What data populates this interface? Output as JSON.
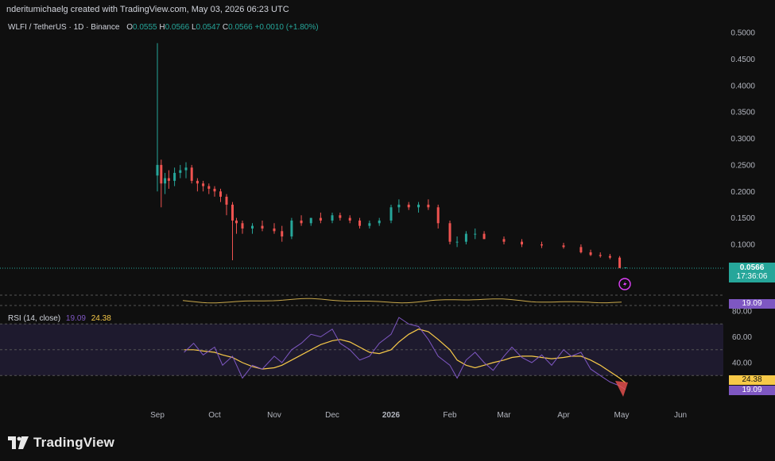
{
  "header": {
    "attribution": "nderitumichaelg created with TradingView.com, May 03, 2026 06:23 UTC"
  },
  "legend": {
    "symbol": "WLFI / TetherUS · 1D · Binance",
    "o_label": "O",
    "o_value": "0.0555",
    "h_label": "H",
    "h_value": "0.0566",
    "l_label": "L",
    "l_value": "0.0547",
    "c_label": "C",
    "c_value": "0.0566",
    "change": "+0.0010 (+1.80%)"
  },
  "rsi_legend": {
    "label": "RSI (14, close)",
    "rsi_value": "19.09",
    "ma_value": "24.38"
  },
  "price_tag": {
    "price": "0.0566",
    "countdown": "17:36:06"
  },
  "mini_tag": {
    "value": "19.09"
  },
  "rsi_tags": {
    "ma": "24.38",
    "rsi": "19.09"
  },
  "colors": {
    "background": "#0f0f0f",
    "up": "#26a69a",
    "down": "#ef5350",
    "rsi_line": "#7e57c2",
    "rsi_ma": "#f7c948",
    "rsi_band": "#1e1a2e",
    "price_tag": "#26a69a",
    "rsi_tag": "#7e57c2",
    "ma_tag": "#f7c948",
    "lightning": "#e040fb"
  },
  "icons": {
    "alert": "lightning-icon",
    "logo": "tradingview-logo-icon"
  },
  "footer": {
    "brand": "TradingView"
  },
  "chart_data": [
    {
      "type": "candlestick",
      "title": "WLFI / TetherUS · 1D · Binance",
      "y_ticks": [
        "0.5000",
        "0.4500",
        "0.4000",
        "0.3500",
        "0.3000",
        "0.2500",
        "0.2000",
        "0.1500",
        "0.1000"
      ],
      "ylim": [
        0.0,
        0.5
      ],
      "x_ticks": [
        "Sep",
        "Oct",
        "Nov",
        "Dec",
        "2026",
        "Feb",
        "Mar",
        "Apr",
        "May",
        "Jun"
      ],
      "grid": false,
      "series": [
        {
          "x": [
            "Sep 01",
            "Sep 03",
            "Sep 05",
            "Sep 07",
            "Sep 10",
            "Sep 13",
            "Sep 16",
            "Sep 19",
            "Sep 22",
            "Sep 25",
            "Sep 28",
            "Oct 01",
            "Oct 04",
            "Oct 07",
            "Oct 10",
            "Oct 12",
            "Oct 15",
            "Oct 20",
            "Oct 25",
            "Nov 01",
            "Nov 05",
            "Nov 10",
            "Nov 15",
            "Nov 20",
            "Nov 25",
            "Dec 01",
            "Dec 05",
            "Dec 10",
            "Dec 15",
            "Dec 20",
            "Dec 25",
            "Jan 01",
            "Jan 05",
            "Jan 10",
            "Jan 15",
            "Jan 20",
            "Jan 25",
            "Feb 01",
            "Feb 05",
            "Feb 10",
            "Feb 15",
            "Feb 20",
            "Mar 01",
            "Mar 10",
            "Mar 20",
            "Apr 01",
            "Apr 10",
            "Apr 15",
            "Apr 20",
            "Apr 25",
            "Apr 30",
            "May 03"
          ],
          "open": [
            0.23,
            0.25,
            0.215,
            0.225,
            0.22,
            0.235,
            0.24,
            0.245,
            0.22,
            0.215,
            0.21,
            0.205,
            0.2,
            0.19,
            0.175,
            0.145,
            0.14,
            0.13,
            0.135,
            0.13,
            0.125,
            0.115,
            0.145,
            0.14,
            0.15,
            0.145,
            0.155,
            0.15,
            0.145,
            0.135,
            0.14,
            0.145,
            0.17,
            0.175,
            0.17,
            0.175,
            0.17,
            0.14,
            0.105,
            0.105,
            0.12,
            0.12,
            0.11,
            0.105,
            0.1,
            0.098,
            0.095,
            0.085,
            0.08,
            0.078,
            0.075,
            0.0555
          ],
          "high": [
            0.48,
            0.26,
            0.235,
            0.24,
            0.245,
            0.25,
            0.255,
            0.25,
            0.225,
            0.22,
            0.215,
            0.21,
            0.205,
            0.195,
            0.18,
            0.15,
            0.145,
            0.14,
            0.145,
            0.14,
            0.135,
            0.15,
            0.155,
            0.15,
            0.16,
            0.16,
            0.16,
            0.155,
            0.15,
            0.145,
            0.15,
            0.175,
            0.185,
            0.18,
            0.18,
            0.185,
            0.175,
            0.145,
            0.115,
            0.125,
            0.13,
            0.125,
            0.115,
            0.11,
            0.105,
            0.103,
            0.1,
            0.09,
            0.085,
            0.082,
            0.078,
            0.0566
          ],
          "low": [
            0.2,
            0.17,
            0.195,
            0.205,
            0.21,
            0.225,
            0.225,
            0.215,
            0.2,
            0.2,
            0.195,
            0.19,
            0.18,
            0.155,
            0.07,
            0.12,
            0.12,
            0.12,
            0.125,
            0.12,
            0.105,
            0.11,
            0.135,
            0.135,
            0.14,
            0.14,
            0.145,
            0.14,
            0.13,
            0.13,
            0.135,
            0.14,
            0.16,
            0.165,
            0.16,
            0.165,
            0.13,
            0.1,
            0.095,
            0.1,
            0.11,
            0.11,
            0.1,
            0.095,
            0.093,
            0.092,
            0.083,
            0.078,
            0.075,
            0.072,
            0.055,
            0.0547
          ],
          "close": [
            0.25,
            0.215,
            0.225,
            0.22,
            0.235,
            0.24,
            0.245,
            0.22,
            0.215,
            0.21,
            0.205,
            0.2,
            0.19,
            0.175,
            0.145,
            0.14,
            0.13,
            0.135,
            0.13,
            0.125,
            0.115,
            0.145,
            0.14,
            0.15,
            0.145,
            0.155,
            0.15,
            0.145,
            0.135,
            0.14,
            0.145,
            0.17,
            0.175,
            0.17,
            0.175,
            0.17,
            0.14,
            0.105,
            0.105,
            0.12,
            0.12,
            0.11,
            0.105,
            0.1,
            0.098,
            0.095,
            0.085,
            0.08,
            0.078,
            0.075,
            0.0555,
            0.0566
          ]
        }
      ]
    },
    {
      "type": "line",
      "title": "RSI (14, close)",
      "y_ticks": [
        "80.00",
        "60.00",
        "40.00"
      ],
      "ylim": [
        10,
        85
      ],
      "bands": [
        70,
        50,
        30
      ],
      "x": [
        "Sep 15",
        "Sep 20",
        "Sep 25",
        "Oct 01",
        "Oct 05",
        "Oct 10",
        "Oct 15",
        "Oct 20",
        "Oct 25",
        "Nov 01",
        "Nov 05",
        "Nov 10",
        "Nov 15",
        "Nov 20",
        "Nov 25",
        "Dec 01",
        "Dec 05",
        "Dec 10",
        "Dec 15",
        "Dec 20",
        "Dec 25",
        "Jan 01",
        "Jan 05",
        "Jan 10",
        "Jan 15",
        "Jan 20",
        "Jan 25",
        "Feb 01",
        "Feb 05",
        "Feb 10",
        "Feb 15",
        "Feb 20",
        "Feb 25",
        "Mar 01",
        "Mar 05",
        "Mar 10",
        "Mar 15",
        "Mar 20",
        "Mar 25",
        "Apr 01",
        "Apr 05",
        "Apr 10",
        "Apr 15",
        "Apr 20",
        "Apr 25",
        "Apr 30",
        "May 03"
      ],
      "series": [
        {
          "name": "RSI",
          "values": [
            48,
            55,
            46,
            52,
            38,
            45,
            28,
            38,
            35,
            45,
            40,
            50,
            55,
            62,
            60,
            66,
            55,
            50,
            42,
            45,
            55,
            62,
            75,
            70,
            68,
            58,
            45,
            38,
            28,
            42,
            48,
            40,
            34,
            45,
            52,
            44,
            40,
            46,
            38,
            50,
            45,
            48,
            35,
            30,
            25,
            22,
            19.09
          ]
        },
        {
          "name": "RSI MA",
          "values": [
            50,
            50,
            49,
            48,
            46,
            44,
            40,
            37,
            35,
            36,
            38,
            42,
            46,
            50,
            54,
            57,
            58,
            56,
            52,
            48,
            47,
            50,
            56,
            62,
            66,
            64,
            58,
            50,
            42,
            38,
            36,
            38,
            40,
            42,
            44,
            45,
            45,
            44,
            43,
            44,
            45,
            45,
            42,
            38,
            33,
            28,
            24.38
          ]
        }
      ]
    }
  ]
}
